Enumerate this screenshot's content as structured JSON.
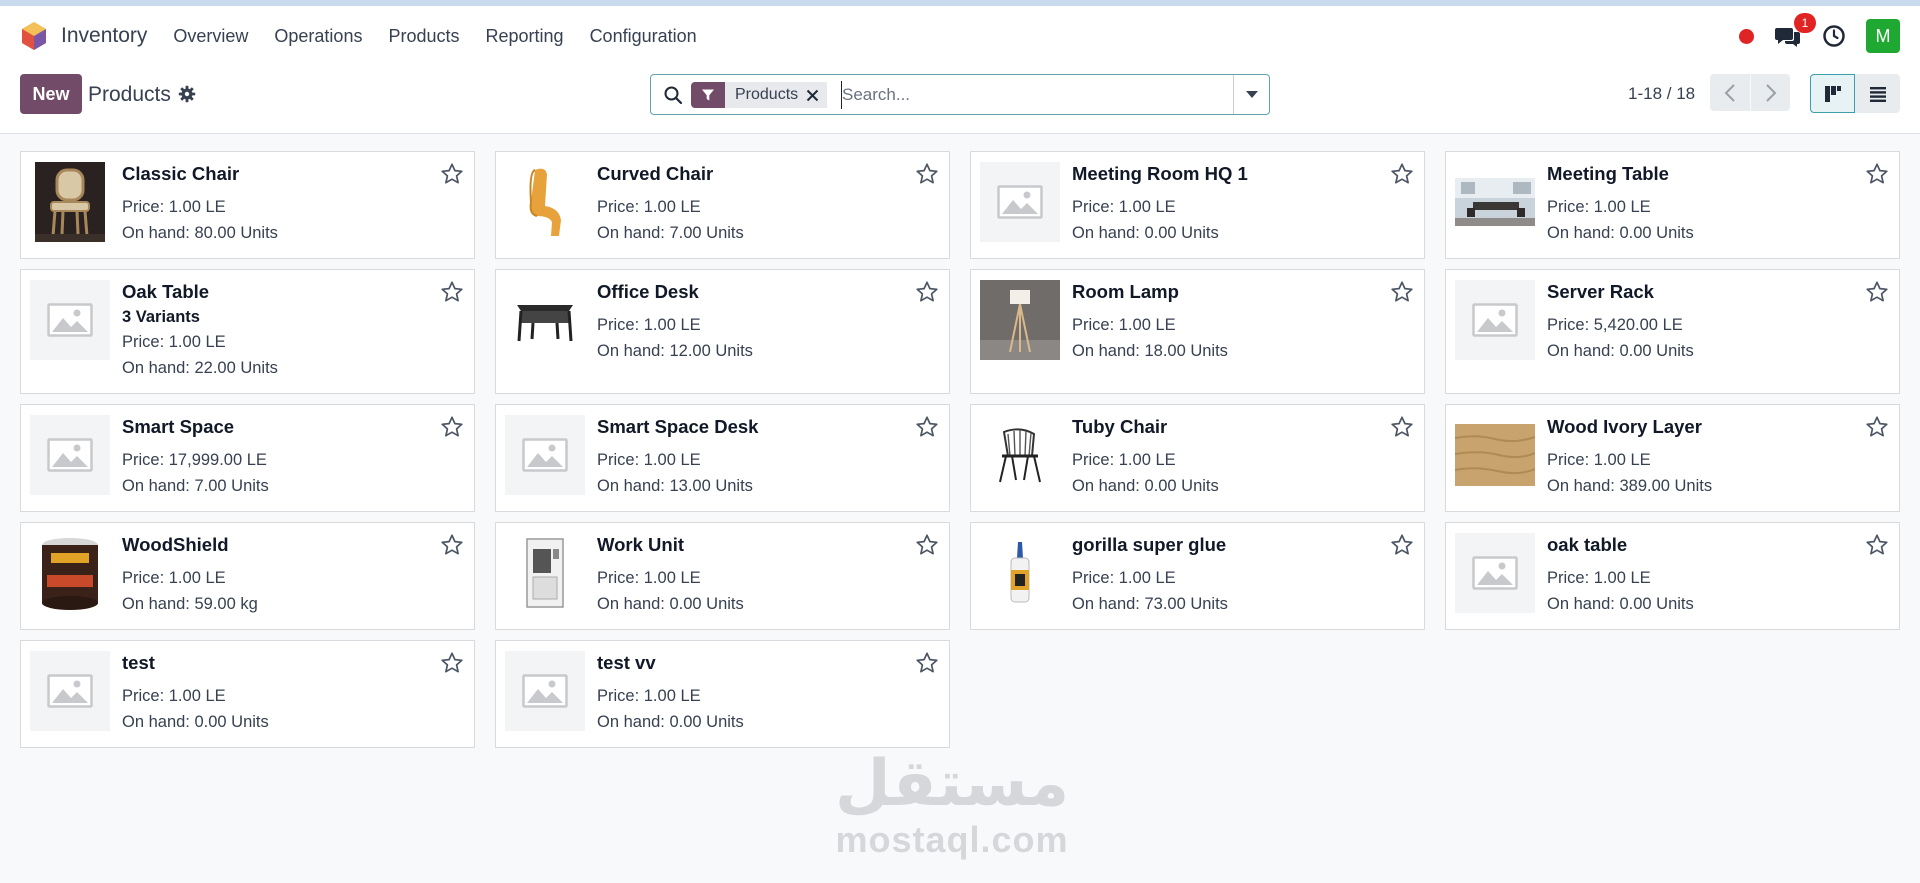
{
  "navbar": {
    "app_name": "Inventory",
    "menu": [
      "Overview",
      "Operations",
      "Products",
      "Reporting",
      "Configuration"
    ],
    "chat_badge": "1",
    "avatar_letter": "M",
    "colors": {
      "record": "#e02424",
      "badge": "#e02424",
      "avatar": "#1fa832"
    }
  },
  "control_panel": {
    "new_label": "New",
    "title": "Products",
    "search": {
      "facet_label": "Products",
      "placeholder": "Search..."
    },
    "pager": "1-18 / 18",
    "active_view": "kanban"
  },
  "icons": {
    "app_logo": "hexagon-logo-icon",
    "record": "record-dot-icon",
    "chat": "chat-bubbles-icon",
    "activity": "clock-icon",
    "settings": "gear-icon",
    "search": "magnifier-icon",
    "facet": "filter-funnel-icon",
    "remove": "close-icon",
    "toggle": "caret-down-icon",
    "prev": "chevron-left-icon",
    "next": "chevron-right-icon",
    "kanban": "kanban-view-icon",
    "list": "list-view-icon",
    "favorite": "star-outline-icon"
  },
  "products": [
    {
      "name": "Classic Chair",
      "price": "Price: 1.00 LE",
      "on_hand": "On hand: 80.00 Units",
      "image": "classic-chair"
    },
    {
      "name": "Curved Chair",
      "price": "Price: 1.00 LE",
      "on_hand": "On hand: 7.00 Units",
      "image": "curved-chair"
    },
    {
      "name": "Meeting Room HQ 1",
      "price": "Price: 1.00 LE",
      "on_hand": "On hand: 0.00 Units",
      "image": "placeholder"
    },
    {
      "name": "Meeting Table",
      "price": "Price: 1.00 LE",
      "on_hand": "On hand: 0.00 Units",
      "image": "meeting-table"
    },
    {
      "name": "Oak Table",
      "variants": "3 Variants",
      "price": "Price: 1.00 LE",
      "on_hand": "On hand: 22.00 Units",
      "image": "placeholder"
    },
    {
      "name": "Office Desk",
      "price": "Price: 1.00 LE",
      "on_hand": "On hand: 12.00 Units",
      "image": "office-desk"
    },
    {
      "name": "Room Lamp",
      "price": "Price: 1.00 LE",
      "on_hand": "On hand: 18.00 Units",
      "image": "room-lamp"
    },
    {
      "name": "Server Rack",
      "price": "Price: 5,420.00 LE",
      "on_hand": "On hand: 0.00 Units",
      "image": "placeholder"
    },
    {
      "name": "Smart Space",
      "price": "Price: 17,999.00 LE",
      "on_hand": "On hand: 7.00 Units",
      "image": "placeholder"
    },
    {
      "name": "Smart Space Desk",
      "price": "Price: 1.00 LE",
      "on_hand": "On hand: 13.00 Units",
      "image": "placeholder"
    },
    {
      "name": "Tuby Chair",
      "price": "Price: 1.00 LE",
      "on_hand": "On hand: 0.00 Units",
      "image": "tuby-chair"
    },
    {
      "name": "Wood Ivory Layer",
      "price": "Price: 1.00 LE",
      "on_hand": "On hand: 389.00 Units",
      "image": "wood-layer"
    },
    {
      "name": "WoodShield",
      "price": "Price: 1.00 LE",
      "on_hand": "On hand: 59.00 kg",
      "image": "paint-can"
    },
    {
      "name": "Work Unit",
      "price": "Price: 1.00 LE",
      "on_hand": "On hand: 0.00 Units",
      "image": "work-unit"
    },
    {
      "name": "gorilla super glue",
      "price": "Price: 1.00 LE",
      "on_hand": "On hand: 73.00 Units",
      "image": "glue-bottle"
    },
    {
      "name": "oak table",
      "price": "Price: 1.00 LE",
      "on_hand": "On hand: 0.00 Units",
      "image": "placeholder"
    },
    {
      "name": "test",
      "price": "Price: 1.00 LE",
      "on_hand": "On hand: 0.00 Units",
      "image": "placeholder"
    },
    {
      "name": "test vv",
      "price": "Price: 1.00 LE",
      "on_hand": "On hand: 0.00 Units",
      "image": "placeholder"
    }
  ],
  "watermark": {
    "arabic": "مستقل",
    "latin": "mostaql.com"
  }
}
